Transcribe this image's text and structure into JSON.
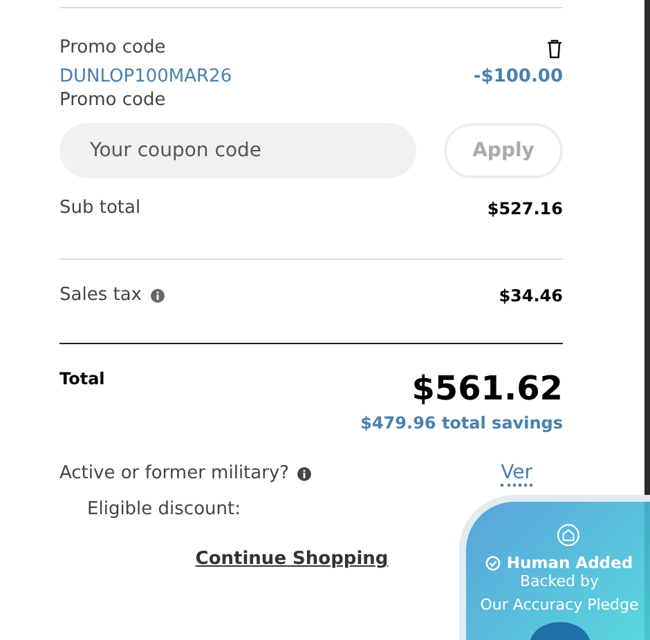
{
  "promo": {
    "label": "Promo code",
    "code": "DUNLOP100MAR26",
    "amount": "-$100.00"
  },
  "coupon": {
    "label": "Promo code",
    "placeholder": "Your coupon code",
    "button": "Apply",
    "disabled": true
  },
  "subtotal": {
    "label": "Sub total",
    "value": "$527.16"
  },
  "tax": {
    "label": "Sales tax",
    "value": "$34.46"
  },
  "total": {
    "label": "Total",
    "value": "$561.62",
    "savings": "$479.96 total savings"
  },
  "military": {
    "label": "Active or former military?",
    "discount_label": "Eligible discount:",
    "verify": "Ver"
  },
  "continue": "Continue Shopping",
  "badge": {
    "title": "Human Added",
    "line1": "Backed by",
    "line2": "Our Accuracy Pledge"
  }
}
